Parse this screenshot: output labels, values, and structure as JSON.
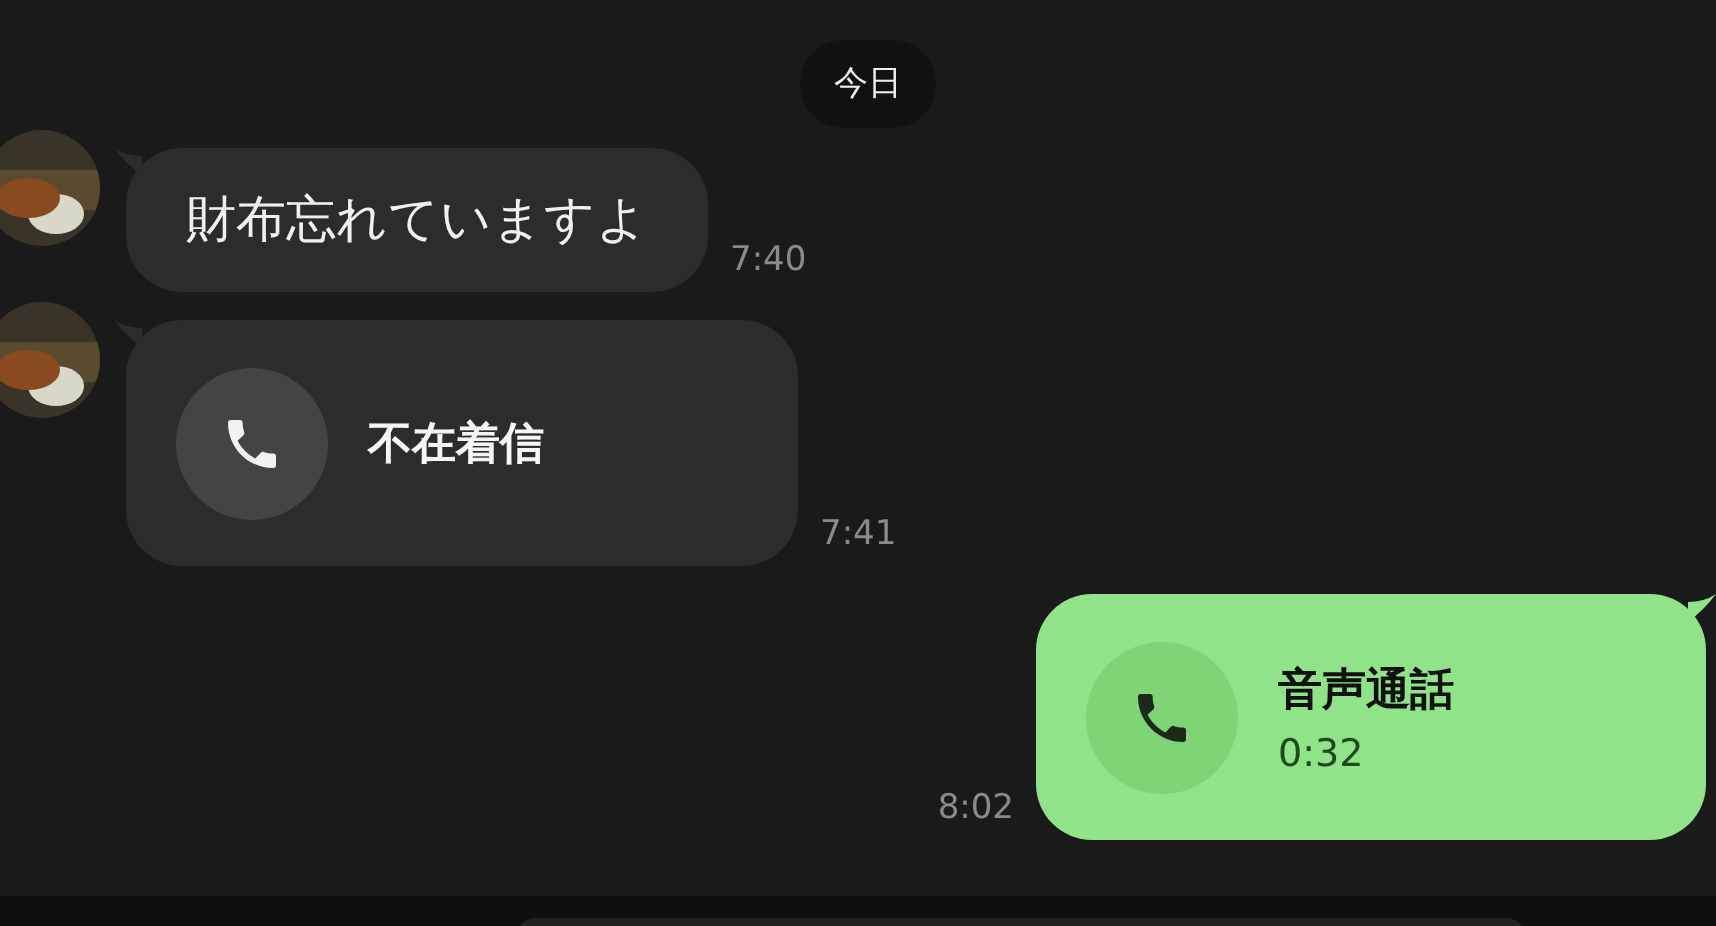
{
  "date_chip": "今日",
  "messages": [
    {
      "kind": "text",
      "outgoing": false,
      "text": "財布忘れていますよ",
      "time": "7:40"
    },
    {
      "kind": "call",
      "outgoing": false,
      "title": "不在着信",
      "time": "7:41"
    },
    {
      "kind": "call",
      "outgoing": true,
      "title": "音声通話",
      "duration": "0:32",
      "time": "8:02"
    }
  ]
}
